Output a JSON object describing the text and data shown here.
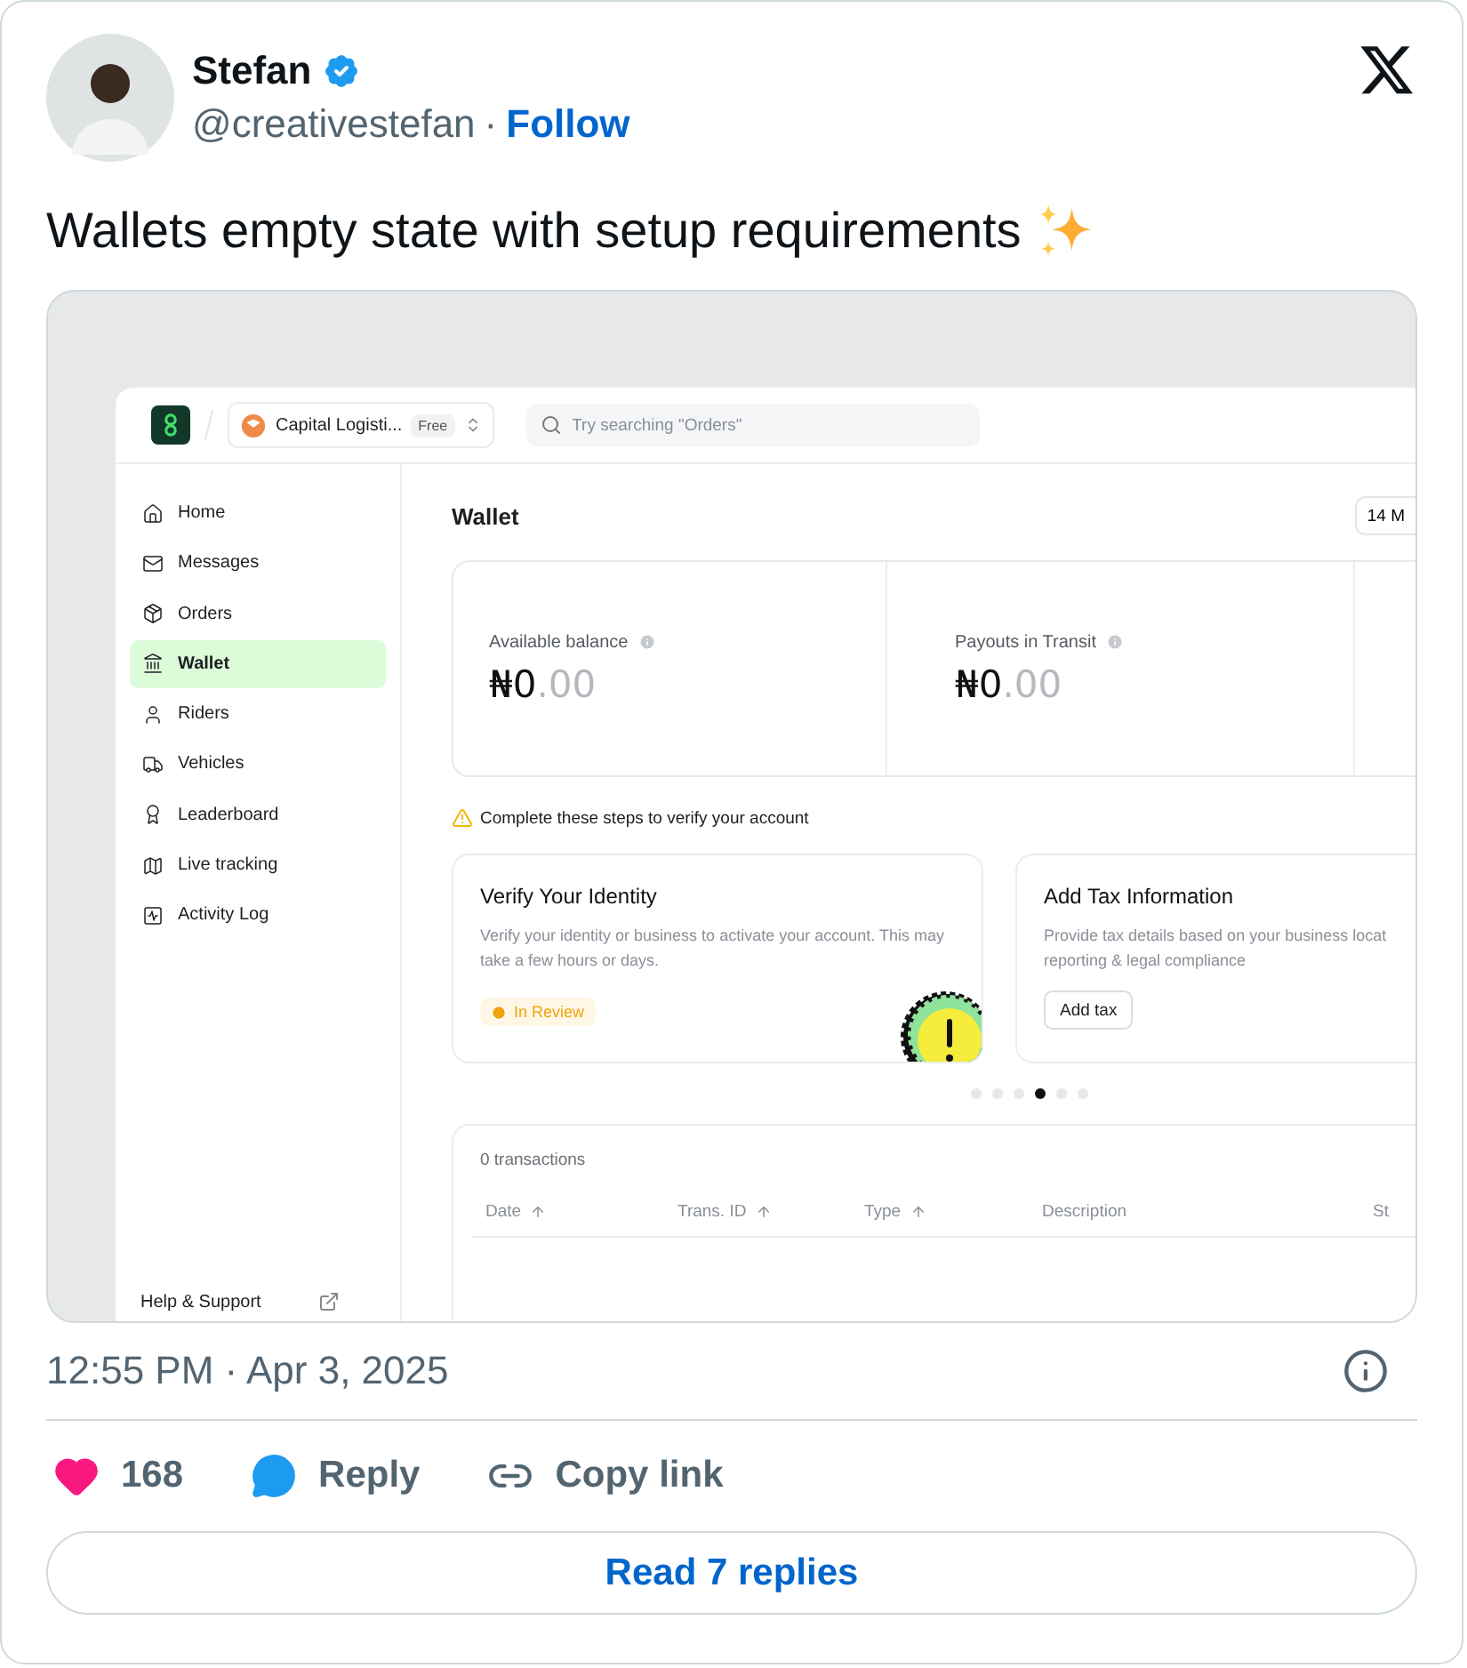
{
  "author": {
    "name": "Stefan",
    "verified": true,
    "handle": "@creativestefan",
    "separator": "·",
    "follow": "Follow"
  },
  "text": "Wallets empty state with setup requirements",
  "embed": {
    "topbar": {
      "company": "Capital Logisti...",
      "plan": "Free",
      "search_placeholder": "Try searching \"Orders\""
    },
    "sidebar": {
      "items": [
        {
          "label": "Home",
          "selected": false
        },
        {
          "label": "Messages",
          "selected": false
        },
        {
          "label": "Orders",
          "selected": false
        },
        {
          "label": "Wallet",
          "selected": true
        },
        {
          "label": "Riders",
          "selected": false
        },
        {
          "label": "Vehicles",
          "selected": false
        },
        {
          "label": "Leaderboard",
          "selected": false
        },
        {
          "label": "Live tracking",
          "selected": false
        },
        {
          "label": "Activity Log",
          "selected": false
        }
      ],
      "footer": "Help & Support"
    },
    "title": "Wallet",
    "date_button": "14 M",
    "balances": [
      {
        "label": "Available balance",
        "whole": "₦0",
        "fraction": ".00"
      },
      {
        "label": "Payouts in Transit",
        "whole": "₦0",
        "fraction": ".00"
      }
    ],
    "notice": "Complete these steps to verify your account",
    "steps": [
      {
        "kind": "status",
        "title": "Verify Your Identity",
        "description": "Verify your identity or business to activate your account. This may take a few hours or days.",
        "status": "In Review"
      },
      {
        "kind": "button",
        "title": "Add Tax Information",
        "description": "Provide tax details based on your business locat",
        "description_2": "reporting & legal compliance",
        "button": "Add tax"
      }
    ],
    "carousel_dots": [
      {
        "selected": false
      },
      {
        "selected": false
      },
      {
        "selected": false
      },
      {
        "selected": true
      },
      {
        "selected": false
      },
      {
        "selected": false
      }
    ],
    "transactions": {
      "count": "0 transactions",
      "columns": [
        {
          "label": "Date",
          "sortable": true
        },
        {
          "label": "Trans. ID",
          "sortable": true
        },
        {
          "label": "Type",
          "sortable": true
        },
        {
          "label": "Description",
          "sortable": false
        },
        {
          "label": "St",
          "sortable": false
        }
      ]
    }
  },
  "timestamp": "12:55 PM · Apr 3, 2025",
  "likes": "168",
  "reply": "Reply",
  "copy_link": "Copy link",
  "read_replies": "Read 7 replies"
}
